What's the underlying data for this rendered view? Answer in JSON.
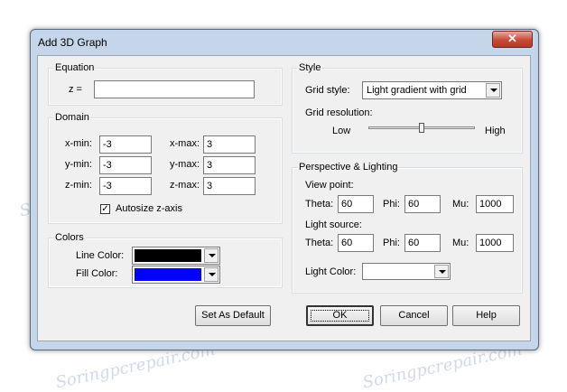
{
  "window": {
    "title": "Add 3D Graph",
    "close_glyph": "✕"
  },
  "equation": {
    "legend": "Equation",
    "z_label": "z =",
    "z_value": ""
  },
  "domain": {
    "legend": "Domain",
    "xmin_label": "x-min:",
    "xmin_value": "-3",
    "xmax_label": "x-max:",
    "xmax_value": "3",
    "ymin_label": "y-min:",
    "ymin_value": "-3",
    "ymax_label": "y-max:",
    "ymax_value": "3",
    "zmin_label": "z-min:",
    "zmin_value": "-3",
    "zmax_label": "z-max:",
    "zmax_value": "3",
    "autosize_label": "Autosize z-axis",
    "autosize_checked": true,
    "check_glyph": "✓"
  },
  "colors": {
    "legend": "Colors",
    "line_label": "Line Color:",
    "line_color": "#000000",
    "fill_label": "Fill Color:",
    "fill_color": "#0000ff"
  },
  "style": {
    "legend": "Style",
    "grid_style_label": "Grid style:",
    "grid_style_value": "Light gradient with grid",
    "grid_resolution_label": "Grid resolution:",
    "low_label": "Low",
    "high_label": "High",
    "resolution_level": 0.5
  },
  "perspective": {
    "legend": "Perspective & Lighting",
    "view_point_label": "View point:",
    "vp_theta_label": "Theta:",
    "vp_theta_value": "60",
    "vp_phi_label": "Phi:",
    "vp_phi_value": "60",
    "vp_mu_label": "Mu:",
    "vp_mu_value": "1000",
    "light_source_label": "Light source:",
    "ls_theta_label": "Theta:",
    "ls_theta_value": "60",
    "ls_phi_label": "Phi:",
    "ls_phi_value": "60",
    "ls_mu_label": "Mu:",
    "ls_mu_value": "1000",
    "light_color_label": "Light Color:",
    "light_color": "#ffffff"
  },
  "buttons": {
    "set_default": "Set As Default",
    "ok": "OK",
    "cancel": "Cancel",
    "help": "Help"
  },
  "watermark": "Soringpcrepair.com",
  "colors_palette": {
    "client_bg": "#f0f0f0",
    "frame": "#c5d6ea",
    "close": "#c74a36"
  }
}
